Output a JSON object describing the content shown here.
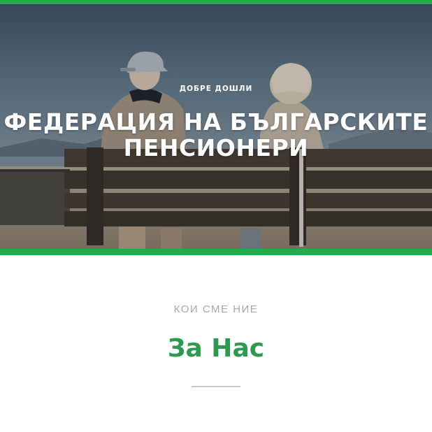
{
  "hero": {
    "subtitle": "ДОБРЕ ДОШЛИ",
    "title_line1": "ФЕДЕРАЦИЯ НА БЪЛГАРСКИТЕ",
    "title_line2": "ПЕНСИОНЕРИ",
    "image": "elderly-couple-on-bench-photo"
  },
  "about": {
    "kicker": "КОИ СМЕ НИЕ",
    "heading": "За Нас"
  },
  "colors": {
    "accent": "#1fae4b",
    "heading": "#2e9a4f",
    "kicker": "#a8a8a8",
    "divider": "#c8c8c8"
  }
}
